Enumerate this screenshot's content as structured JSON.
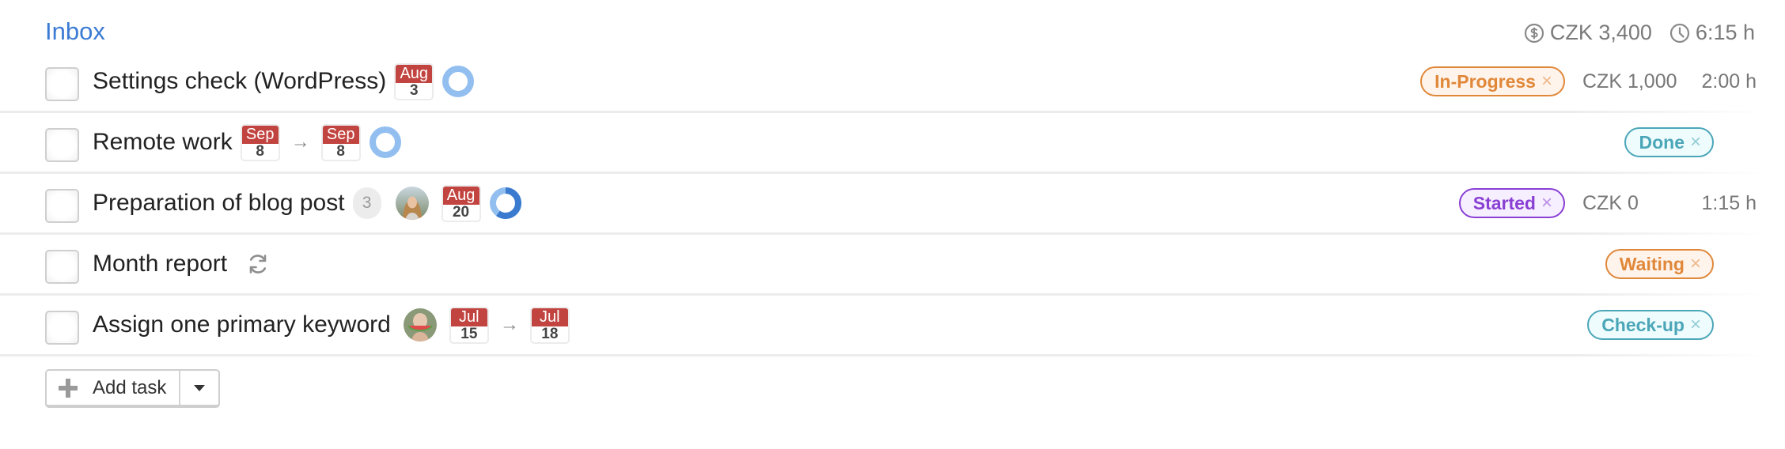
{
  "header": {
    "title": "Inbox",
    "total_cost": "CZK 3,400",
    "total_time": "6:15 h",
    "cost_icon": "dollar-circle-icon",
    "time_icon": "clock-icon"
  },
  "colors": {
    "accent": "#3b7bd4",
    "calendar_red": "#c24440",
    "ring_light": "#93bff0",
    "ring_dark": "#3a7bd0"
  },
  "tasks": [
    {
      "title": "Settings check (WordPress)",
      "dates": [
        {
          "month": "Aug",
          "day": "3"
        }
      ],
      "progress": 0,
      "tag": {
        "label": "In-Progress",
        "color": "#e0883a",
        "bg": "#fff4ec"
      },
      "cost": "CZK 1,000",
      "time": "2:00 h"
    },
    {
      "title": "Remote work",
      "dates": [
        {
          "month": "Sep",
          "day": "8"
        },
        {
          "month": "Sep",
          "day": "8"
        }
      ],
      "progress": 0,
      "tag": {
        "label": "Done",
        "color": "#4ba6b8",
        "bg": "#effcfd"
      }
    },
    {
      "title": "Preparation of blog post",
      "comment_count": "3",
      "assignee_avatar": "avatar-woman",
      "dates": [
        {
          "month": "Aug",
          "day": "20"
        }
      ],
      "progress": 0.6,
      "tag": {
        "label": "Started",
        "color": "#8a3fd4",
        "bg": "#f6efff"
      },
      "cost": "CZK 0",
      "time": "1:15 h"
    },
    {
      "title": "Month report",
      "recurring_icon": "recurring-icon",
      "tag": {
        "label": "Waiting",
        "color": "#e0883a",
        "bg": "#fff4ec"
      }
    },
    {
      "title": "Assign one primary keyword",
      "assignee_avatar": "avatar-watermelon",
      "dates": [
        {
          "month": "Jul",
          "day": "15"
        },
        {
          "month": "Jul",
          "day": "18"
        }
      ],
      "tag": {
        "label": "Check-up",
        "color": "#4ba6b8",
        "bg": "#effcfd"
      }
    }
  ],
  "arrow_glyph": "→",
  "tag_close_glyph": "×",
  "add_task": {
    "label": "Add task"
  }
}
